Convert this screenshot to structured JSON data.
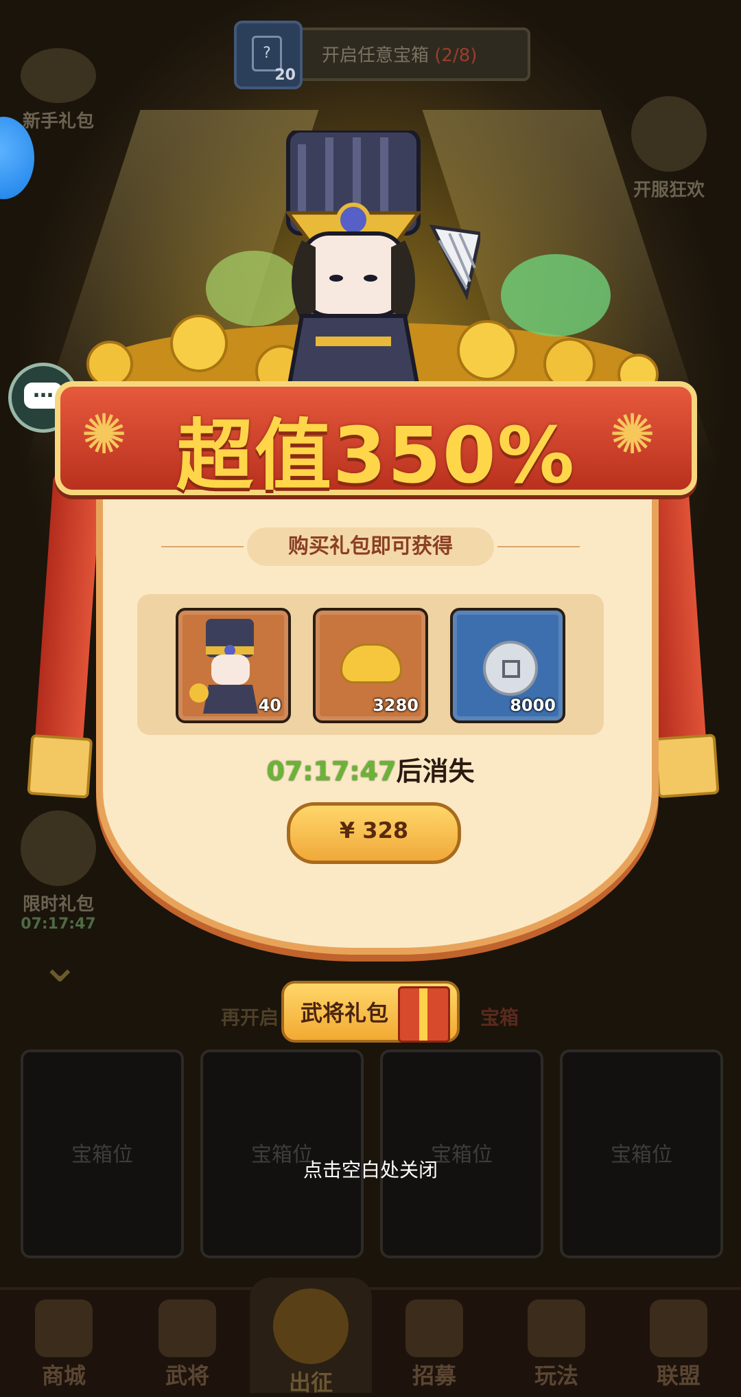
{
  "top_progress": {
    "box_mark": "?",
    "box_count": "20",
    "text": "开启任意宝箱",
    "progress": "(2/8)"
  },
  "side_left": [
    {
      "label": "新手礼包"
    },
    {
      "label": "限时礼包",
      "timer": "07:17:47"
    }
  ],
  "side_right": [
    {
      "label": "开服狂欢"
    }
  ],
  "offer": {
    "title": "超值350%",
    "subhead": "购买礼包即可获得",
    "items": [
      {
        "icon": "hero-portrait-icon",
        "count": "40"
      },
      {
        "icon": "gold-ingot-icon",
        "count": "3280"
      },
      {
        "icon": "copper-coin-icon",
        "count": "8000"
      }
    ],
    "timer": "07:17:47",
    "timer_suffix": "后消失",
    "price": "¥ 328"
  },
  "hero_gift": {
    "label": "武将礼包",
    "behind_left": "再开启",
    "behind_right": "宝箱"
  },
  "chest_slots": [
    "宝箱位",
    "宝箱位",
    "宝箱位",
    "宝箱位"
  ],
  "close_hint": "点击空白处关闭",
  "nav": [
    {
      "label": "商城"
    },
    {
      "label": "武将"
    },
    {
      "label": "出征"
    },
    {
      "label": "招募"
    },
    {
      "label": "玩法"
    },
    {
      "label": "联盟"
    }
  ],
  "colors": {
    "banner": "#d8432a",
    "title_gold": "#ffd64a",
    "timer_green": "#6ab435",
    "panel": "#fbe9c6"
  }
}
